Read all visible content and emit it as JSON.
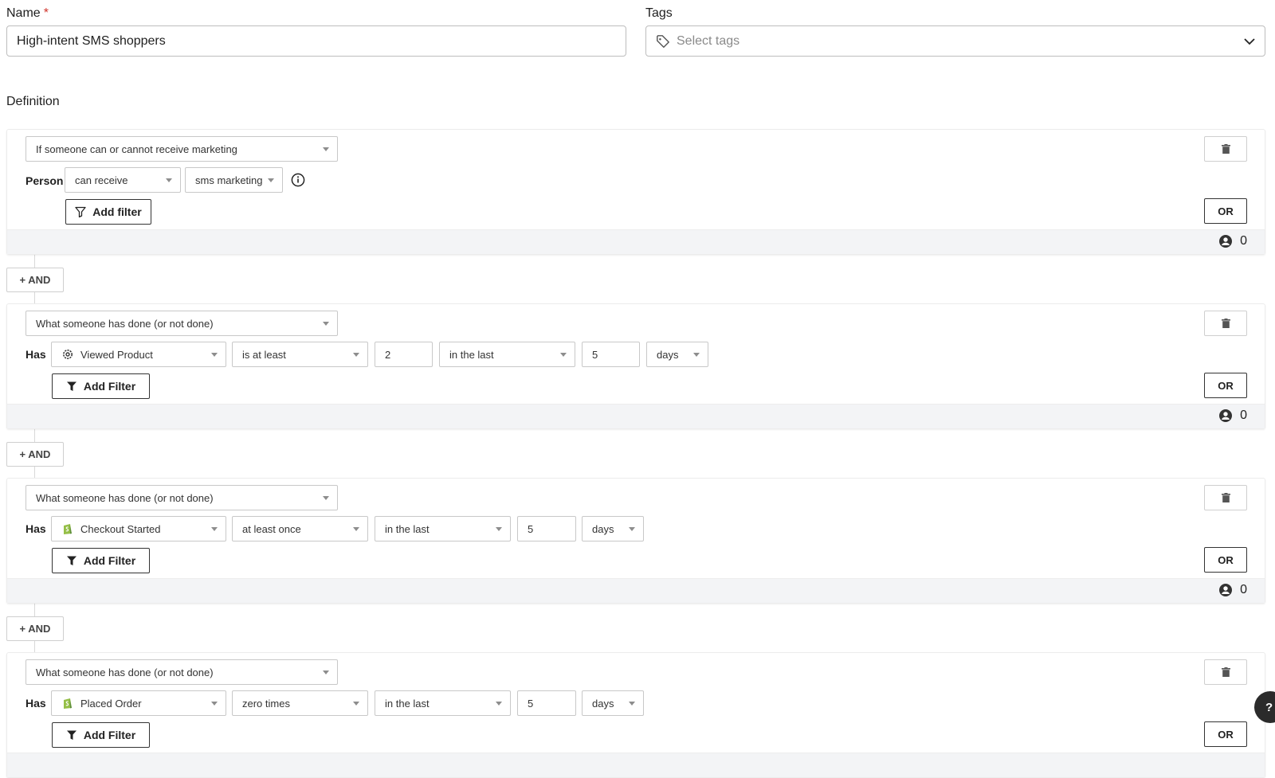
{
  "form": {
    "name_label": "Name",
    "required_marker": "*",
    "name_value": "High-intent SMS shoppers",
    "tags_label": "Tags",
    "tags_placeholder": "Select tags",
    "definition_label": "Definition"
  },
  "conditions": [
    {
      "type": "If someone can or cannot receive marketing",
      "row_label": "Person",
      "fields": [
        "can receive",
        "sms marketing"
      ],
      "add_filter_label": "Add filter",
      "or_label": "OR",
      "count": "0"
    },
    {
      "type": "What someone has done (or not done)",
      "row_label": "Has",
      "event": "Viewed Product",
      "event_icon": "gear-icon",
      "frequency": "is at least",
      "frequency_value": "2",
      "timeframe": "in the last",
      "timeframe_value": "5",
      "unit": "days",
      "add_filter_label": "Add Filter",
      "or_label": "OR",
      "count": "0"
    },
    {
      "type": "What someone has done (or not done)",
      "row_label": "Has",
      "event": "Checkout Started",
      "event_icon": "shopify-icon",
      "frequency": "at least once",
      "timeframe": "in the last",
      "timeframe_value": "5",
      "unit": "days",
      "add_filter_label": "Add Filter",
      "or_label": "OR",
      "count": "0"
    },
    {
      "type": "What someone has done (or not done)",
      "row_label": "Has",
      "event": "Placed Order",
      "event_icon": "shopify-icon",
      "frequency": "zero times",
      "timeframe": "in the last",
      "timeframe_value": "5",
      "unit": "days",
      "add_filter_label": "Add Filter",
      "or_label": "OR"
    }
  ],
  "and_label": "+ AND",
  "help_label": "?",
  "colors": {
    "required": "#d0342c",
    "shopify_green": "#95bf47",
    "footer_bg": "#f3f4f6",
    "help_bg": "#2b2b2b"
  }
}
